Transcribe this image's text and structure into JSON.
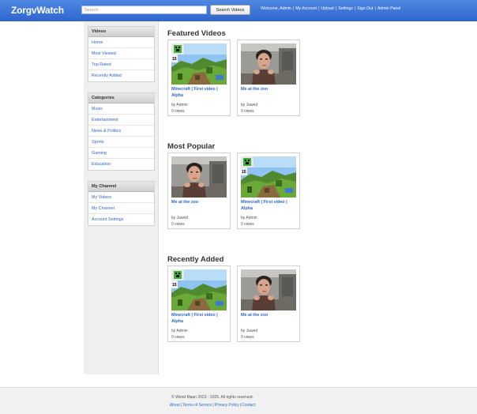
{
  "header": {
    "logo": "ZorgvWatch",
    "search_placeholder": "Search",
    "search_button": "Search Videos",
    "nav": [
      "Welcome, Admin",
      "My Account",
      "Upload",
      "Settings",
      "Sign Out",
      "Admin Panel"
    ]
  },
  "sidebar": {
    "videos": {
      "title": "Videos",
      "items": [
        "Home",
        "Most Viewed",
        "Top Rated",
        "Recently Added"
      ]
    },
    "categories": {
      "title": "Categories",
      "items": [
        "Music",
        "Entertainment",
        "News & Politics",
        "Sports",
        "Gaming",
        "Education"
      ]
    },
    "channel": {
      "title": "My Channel",
      "items": [
        "My Videos",
        "My Channel",
        "Account Settings"
      ]
    }
  },
  "sections": [
    {
      "title": "Featured Videos",
      "videos": [
        {
          "title": "Minecraft | First video | Alpha",
          "author": "by Admin",
          "views": "0 views",
          "thumb": "minecraft"
        },
        {
          "title": "Me at the zoo",
          "author": "by Jawed",
          "views": "0 views",
          "thumb": "zoo"
        }
      ]
    },
    {
      "title": "Most Popular",
      "videos": [
        {
          "title": "Me at the zoo",
          "author": "by Jawed",
          "views": "0 views",
          "thumb": "zoo"
        },
        {
          "title": "Minecraft | First video | Alpha",
          "author": "by Admin",
          "views": "0 views",
          "thumb": "minecraft"
        }
      ]
    },
    {
      "title": "Recently Added",
      "videos": [
        {
          "title": "Minecraft | First video | Alpha",
          "author": "by Admin",
          "views": "0 views",
          "thumb": "minecraft"
        },
        {
          "title": "Me at the zoo",
          "author": "by Jawed",
          "views": "0 views",
          "thumb": "zoo"
        }
      ]
    }
  ],
  "footer": {
    "copyright": "© Weird Maan 2023 - 2025. All rights reserved.",
    "links": [
      "About",
      "Terms of Service",
      "Privacy Policy",
      "Contact"
    ]
  }
}
